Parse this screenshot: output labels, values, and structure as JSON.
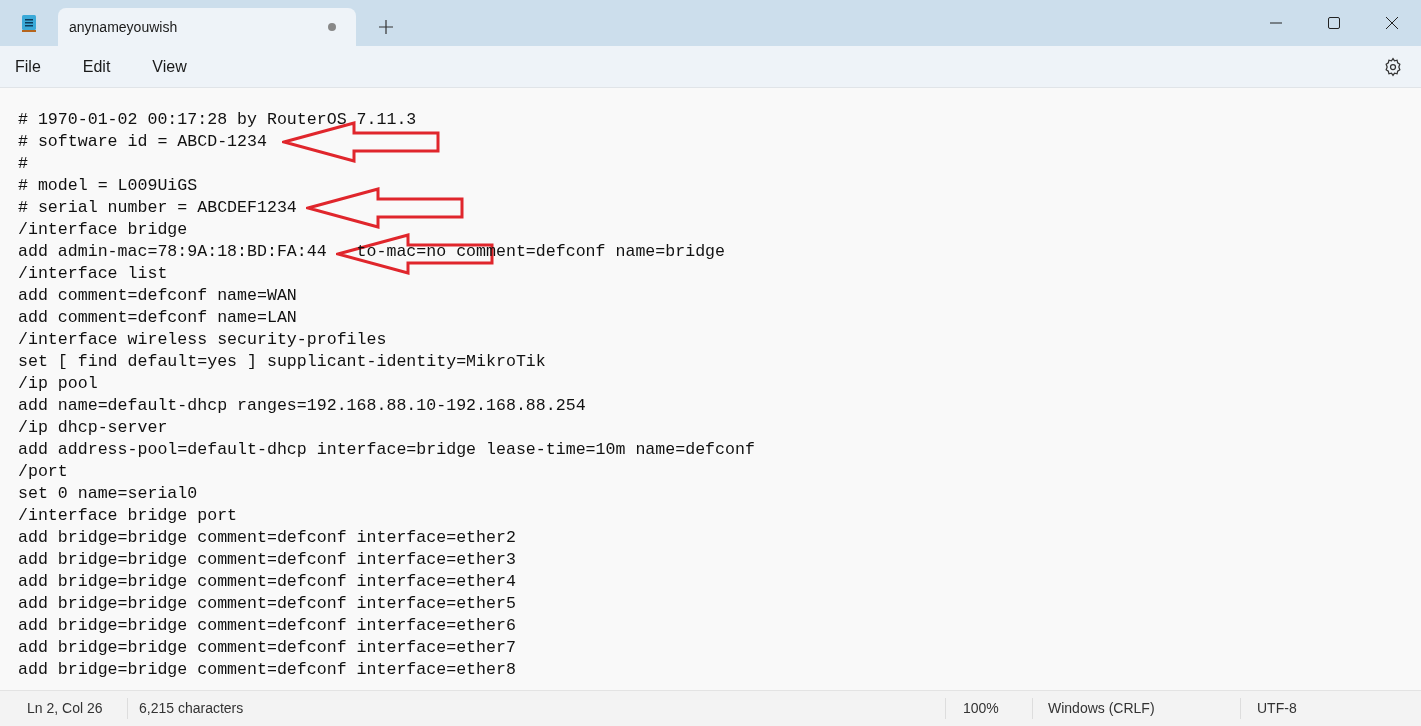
{
  "window": {
    "tab_title": "anynameyouwish",
    "unsaved": true
  },
  "menu": [
    "File",
    "Edit",
    "View"
  ],
  "lines": [
    "# 1970-01-02 00:17:28 by RouterOS 7.11.3",
    "# software id = ABCD-1234",
    "#",
    "# model = L009UiGS",
    "# serial number = ABCDEF1234",
    "/interface bridge",
    {
      "segments": [
        "add admin-mac=78:9A:18:BD:FA:44",
        "to-mac=no comment=defconf name=bridge"
      ]
    },
    "/interface list",
    "add comment=defconf name=WAN",
    "add comment=defconf name=LAN",
    "/interface wireless security-profiles",
    "set [ find default=yes ] supplicant-identity=MikroTik",
    "/ip pool",
    "add name=default-dhcp ranges=192.168.88.10-192.168.88.254",
    "/ip dhcp-server",
    "add address-pool=default-dhcp interface=bridge lease-time=10m name=defconf",
    "/port",
    "set 0 name=serial0",
    "/interface bridge port",
    "add bridge=bridge comment=defconf interface=ether2",
    "add bridge=bridge comment=defconf interface=ether3",
    "add bridge=bridge comment=defconf interface=ether4",
    "add bridge=bridge comment=defconf interface=ether5",
    "add bridge=bridge comment=defconf interface=ether6",
    "add bridge=bridge comment=defconf interface=ether7",
    "add bridge=bridge comment=defconf interface=ether8"
  ],
  "status_bar": {
    "position": "Ln 2, Col 26",
    "characters": "6,215 characters",
    "zoom": "100%",
    "line_ending": "Windows (CRLF)",
    "encoding": "UTF-8"
  }
}
